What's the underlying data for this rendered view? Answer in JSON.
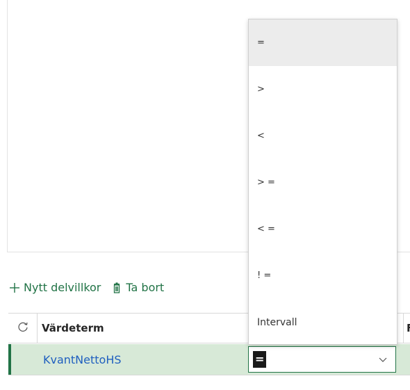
{
  "toolbar": {
    "new_label": "Nytt delvillkor",
    "delete_label": "Ta bort"
  },
  "grid": {
    "columns": [
      {
        "label": "Värdeterm"
      },
      {
        "label": "F"
      }
    ],
    "rows": [
      {
        "value_term": "KvantNettoHS",
        "operator": "="
      }
    ]
  },
  "dropdown": {
    "options": [
      "=",
      ">",
      "<",
      "> =",
      "< =",
      "! =",
      "Intervall"
    ],
    "selected": "="
  },
  "colors": {
    "accent": "#217346",
    "row_highlight": "#d7e9d7",
    "link_blue": "#1f5fbf",
    "option_hover": "#ececec"
  },
  "icons": {
    "add": "plus-icon",
    "delete": "trash-icon",
    "refresh": "refresh-icon",
    "caret": "chevron-down-icon"
  }
}
